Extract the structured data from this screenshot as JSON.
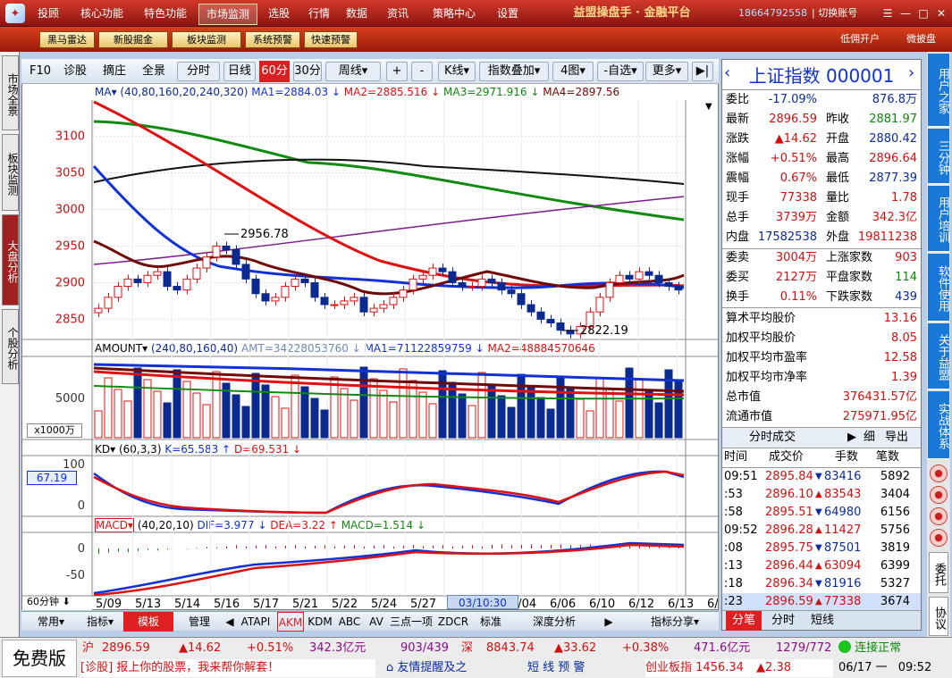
{
  "topbar": {
    "menus": [
      "投顾",
      "核心功能",
      "特色功能",
      "市场监测",
      "选股",
      "行情",
      "数据",
      "资讯",
      "策略中心",
      "设置"
    ],
    "active_menu": "市场监测",
    "brand": "益盟操盘手 · 金融平台",
    "phone": "18664792558",
    "switch_account": "| 切换账号"
  },
  "toolbar2": {
    "buttons": [
      "黑马雷达",
      "新股掘金",
      "板块监测",
      "系统预警",
      "快速预警"
    ],
    "right_links": [
      "低佣开户",
      "微披盘"
    ]
  },
  "left_tabs": [
    "市场全景",
    "板块监测",
    "大盘分析",
    "个股分析"
  ],
  "chart_toolbar": {
    "items": [
      "F10",
      "诊股",
      "摘庄",
      "全景",
      "分时",
      "日线",
      "60分",
      "30分",
      "周线▾",
      "+",
      "-",
      "K线▾",
      "指数叠加▾",
      "4图▾",
      "-自选▾",
      "更多▾",
      "▶|"
    ],
    "active": "60分"
  },
  "legends": {
    "ma": {
      "name": "MA▾",
      "params": "(40,80,160,20,240,320)",
      "ma1": "MA1=2884.03 ↓",
      "ma2": "MA2=2885.516 ↓",
      "ma3": "MA3=2971.916 ↓",
      "ma4": "MA4=2897.56"
    },
    "amount": {
      "name": "AMOUNT▾",
      "params": "(240,80,160,40)",
      "amt": "AMT=34228053760 ↓",
      "ma1": "MA1=71122859759 ↓",
      "ma2": "MA2=48884570646"
    },
    "kd": {
      "name": "KD▾",
      "params": "(60,3,3)",
      "k": "K=65.583 ↑",
      "d": "D=69.531 ↓"
    },
    "macd": {
      "name": "MACD▾",
      "params": "(40,20,10)",
      "dif": "DIF=3.977 ↓",
      "dea": "DEA=3.22 ↑",
      "macd": "MACD=1.514 ↓"
    }
  },
  "axis": {
    "price_ticks": [
      "3100",
      "3050",
      "3000",
      "2950",
      "2900",
      "2850"
    ],
    "amount_tick": "5000",
    "amount_unit": "x1000万",
    "kd_ticks": [
      "100",
      "0"
    ],
    "kd_current": "67.19",
    "macd_ticks": [
      "0",
      "-50"
    ],
    "period_label": "60分钟 ⬇",
    "dates": [
      "5/09",
      "5/13",
      "5/14",
      "5/16",
      "5/17",
      "5/21",
      "5/22",
      "5/24",
      "5/27",
      "5/29",
      "6/04",
      "6/06",
      "6/10",
      "6/12",
      "6/13",
      "6/17"
    ],
    "current_time_label": "03/10:30",
    "annot_high": "2956.78",
    "annot_low": "2822.19"
  },
  "chart_data": {
    "type": "line",
    "candles_close": [
      2865,
      2880,
      2895,
      2905,
      2900,
      2910,
      2915,
      2895,
      2890,
      2905,
      2920,
      2935,
      2950,
      2945,
      2925,
      2905,
      2885,
      2875,
      2880,
      2895,
      2905,
      2900,
      2880,
      2870,
      2870,
      2875,
      2880,
      2860,
      2865,
      2870,
      2880,
      2890,
      2905,
      2910,
      2920,
      2915,
      2900,
      2895,
      2895,
      2905,
      2900,
      2890,
      2885,
      2870,
      2860,
      2850,
      2845,
      2835,
      2830,
      2840,
      2860,
      2880,
      2900,
      2910,
      2905,
      2915,
      2910,
      2900,
      2895,
      2890
    ],
    "ma_series": [
      {
        "name": "MA1",
        "color": "#1030d8"
      },
      {
        "name": "MA2",
        "color": "#e01010"
      },
      {
        "name": "MA3",
        "color": "#108a10"
      },
      {
        "name": "MA4",
        "color": "#700808"
      }
    ],
    "ylim": [
      2820,
      3130
    ]
  },
  "kd_values": {
    "k": 65.583,
    "d": 69.531
  },
  "macd_values": {
    "dif": 3.977,
    "dea": 3.22,
    "macd": 1.514
  },
  "bottom_tabs": [
    "常用▾",
    "指标▾",
    "模板",
    "管理",
    "◀",
    "ATAPI",
    "AKM",
    "KDM",
    "ABC",
    "AV",
    "三点一项",
    "ZDCR",
    "标准",
    "深度分析",
    "▶",
    "指标分享▾"
  ],
  "bottom_active": "模板",
  "quote": {
    "title": "上证指数 000001",
    "rows": [
      {
        "l1": "委比",
        "v1": "-17.09%",
        "l2": "",
        "v2": "876.8万",
        "c1": "blu",
        "c2": "blu"
      },
      {
        "l1": "最新",
        "v1": "2896.59",
        "l2": "昨收",
        "v2": "2881.97",
        "c1": "red",
        "c2": "grn"
      },
      {
        "l1": "涨跌",
        "v1": "▲14.62",
        "l2": "开盘",
        "v2": "2880.42",
        "c1": "red",
        "c2": "blu"
      },
      {
        "l1": "涨幅",
        "v1": "+0.51%",
        "l2": "最高",
        "v2": "2896.64",
        "c1": "red",
        "c2": "red"
      },
      {
        "l1": "震幅",
        "v1": "0.67%",
        "l2": "最低",
        "v2": "2877.39",
        "c1": "red",
        "c2": "blu"
      },
      {
        "l1": "现手",
        "v1": "77338",
        "l2": "量比",
        "v2": "1.78",
        "c1": "red",
        "c2": "red"
      },
      {
        "l1": "总手",
        "v1": "3739万",
        "l2": "金额",
        "v2": "342.3亿",
        "c1": "red",
        "c2": "red"
      },
      {
        "l1": "内盘",
        "v1": "17582538",
        "l2": "外盘",
        "v2": "19811238",
        "c1": "blu",
        "c2": "red"
      }
    ],
    "rows2": [
      {
        "l1": "委卖",
        "v1": "3004万",
        "l2": "上涨家数",
        "v2": "903",
        "c1": "red",
        "c2": "red"
      },
      {
        "l1": "委买",
        "v1": "2127万",
        "l2": "平盘家数",
        "v2": "114",
        "c1": "red",
        "c2": "grn"
      },
      {
        "l1": "换手",
        "v1": "0.11%",
        "l2": "下跌家数",
        "v2": "439",
        "c1": "red",
        "c2": "blu"
      }
    ],
    "stats": [
      {
        "label": "算术平均股价",
        "value": "13.16"
      },
      {
        "label": "加权平均股价",
        "value": "8.05"
      },
      {
        "label": "加权平均市盈率",
        "value": "12.58"
      },
      {
        "label": "加权平均市净率",
        "value": "1.39"
      },
      {
        "label": "总市值",
        "value": "376431.57亿"
      },
      {
        "label": "流通市值",
        "value": "275971.95亿"
      }
    ],
    "trade_header": {
      "title": "分时成交",
      "detail": "细",
      "export": "导出"
    },
    "trade_cols": [
      "时间",
      "成交价",
      "手数",
      "笔数"
    ],
    "trades": [
      {
        "t": "09:51",
        "p": "2895.84",
        "dir": "down",
        "v": "83416",
        "n": "5892"
      },
      {
        "t": ":53",
        "p": "2896.10",
        "dir": "up",
        "v": "83543",
        "n": "3404"
      },
      {
        "t": ":58",
        "p": "2895.51",
        "dir": "down",
        "v": "64980",
        "n": "6156"
      },
      {
        "t": "09:52",
        "p": "2896.28",
        "dir": "up",
        "v": "11427",
        "n": "5756"
      },
      {
        "t": ":08",
        "p": "2895.75",
        "dir": "down",
        "v": "87501",
        "n": "3819"
      },
      {
        "t": ":13",
        "p": "2896.44",
        "dir": "up",
        "v": "63094",
        "n": "6399"
      },
      {
        "t": ":18",
        "p": "2896.34",
        "dir": "down",
        "v": "81916",
        "n": "5327"
      },
      {
        "t": ":23",
        "p": "2896.59",
        "dir": "up",
        "v": "77338",
        "n": "3674"
      }
    ],
    "bottom_tabs": [
      "分笔",
      "分时",
      "短线"
    ]
  },
  "right_tabs": [
    "用户之家",
    "三分钟",
    "用户培训",
    "软件使用",
    "关于益盟",
    "实战体系",
    "委托",
    "协议"
  ],
  "ticker": {
    "free": "免费版",
    "sh_label": "沪",
    "sh_price": "2896.59",
    "sh_chg": "▲14.62",
    "sh_pct": "+0.51%",
    "sh_amt": "342.3亿元",
    "sh_breadth": "903/439",
    "sz_label": "深",
    "sz_price": "8843.74",
    "sz_chg": "▲33.62",
    "sz_pct": "+0.38%",
    "sz_amt": "471.6亿元",
    "sz_breadth": "1279/772",
    "status": "连接正常",
    "line2a": "[诊股] 报上你的股票，我来帮你解套！",
    "line2b": "友情提醒及之",
    "line2c": "短 线 预 警",
    "cyb_label": "创业板指",
    "cyb_price": "1456.34",
    "cyb_chg": "▲2.38",
    "date": "06/17 一",
    "time": "09:52"
  }
}
